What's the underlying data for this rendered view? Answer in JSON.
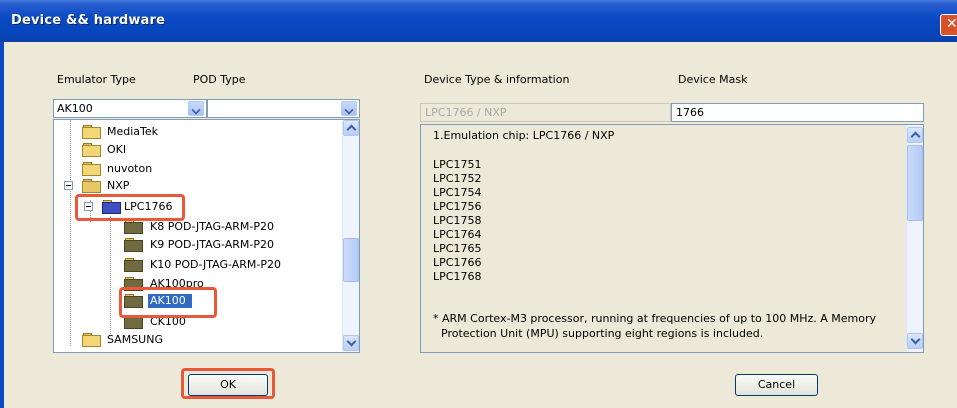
{
  "window": {
    "title": "Device && hardware"
  },
  "left": {
    "emulator_label": "Emulator Type",
    "pod_label": "POD Type",
    "emulator_value": "AK100",
    "pod_value": "",
    "tree": [
      {
        "label": "MediaTek"
      },
      {
        "label": "OKI"
      },
      {
        "label": "nuvoton"
      },
      {
        "label": "NXP"
      },
      {
        "label": "LPC1766"
      },
      {
        "label": "K8  POD-JTAG-ARM-P20"
      },
      {
        "label": "K9  POD-JTAG-ARM-P20"
      },
      {
        "label": "K10  POD-JTAG-ARM-P20"
      },
      {
        "label": "AK100pro"
      },
      {
        "label": "AK100"
      },
      {
        "label": "CK100"
      },
      {
        "label": "SAMSUNG"
      }
    ]
  },
  "right": {
    "device_label": "Device Type & information",
    "mask_label": "Device Mask",
    "device_value": "LPC1766 / NXP",
    "mask_value": "1766",
    "info_lines": [
      "1.Emulation chip: LPC1766 / NXP",
      "LPC1751",
      "LPC1752",
      "LPC1754",
      "LPC1756",
      "LPC1758",
      "LPC1764",
      "LPC1765",
      "LPC1766",
      "LPC1768",
      "* ARM Cortex-M3 processor, running at frequencies of up to 100 MHz. A Memory",
      "Protection Unit (MPU) supporting eight regions is included."
    ]
  },
  "buttons": {
    "ok": "OK",
    "cancel": "Cancel"
  },
  "colors": {
    "titlebar": "#0a4ac4",
    "highlight": "#e8583a",
    "selection": "#316ac5"
  }
}
